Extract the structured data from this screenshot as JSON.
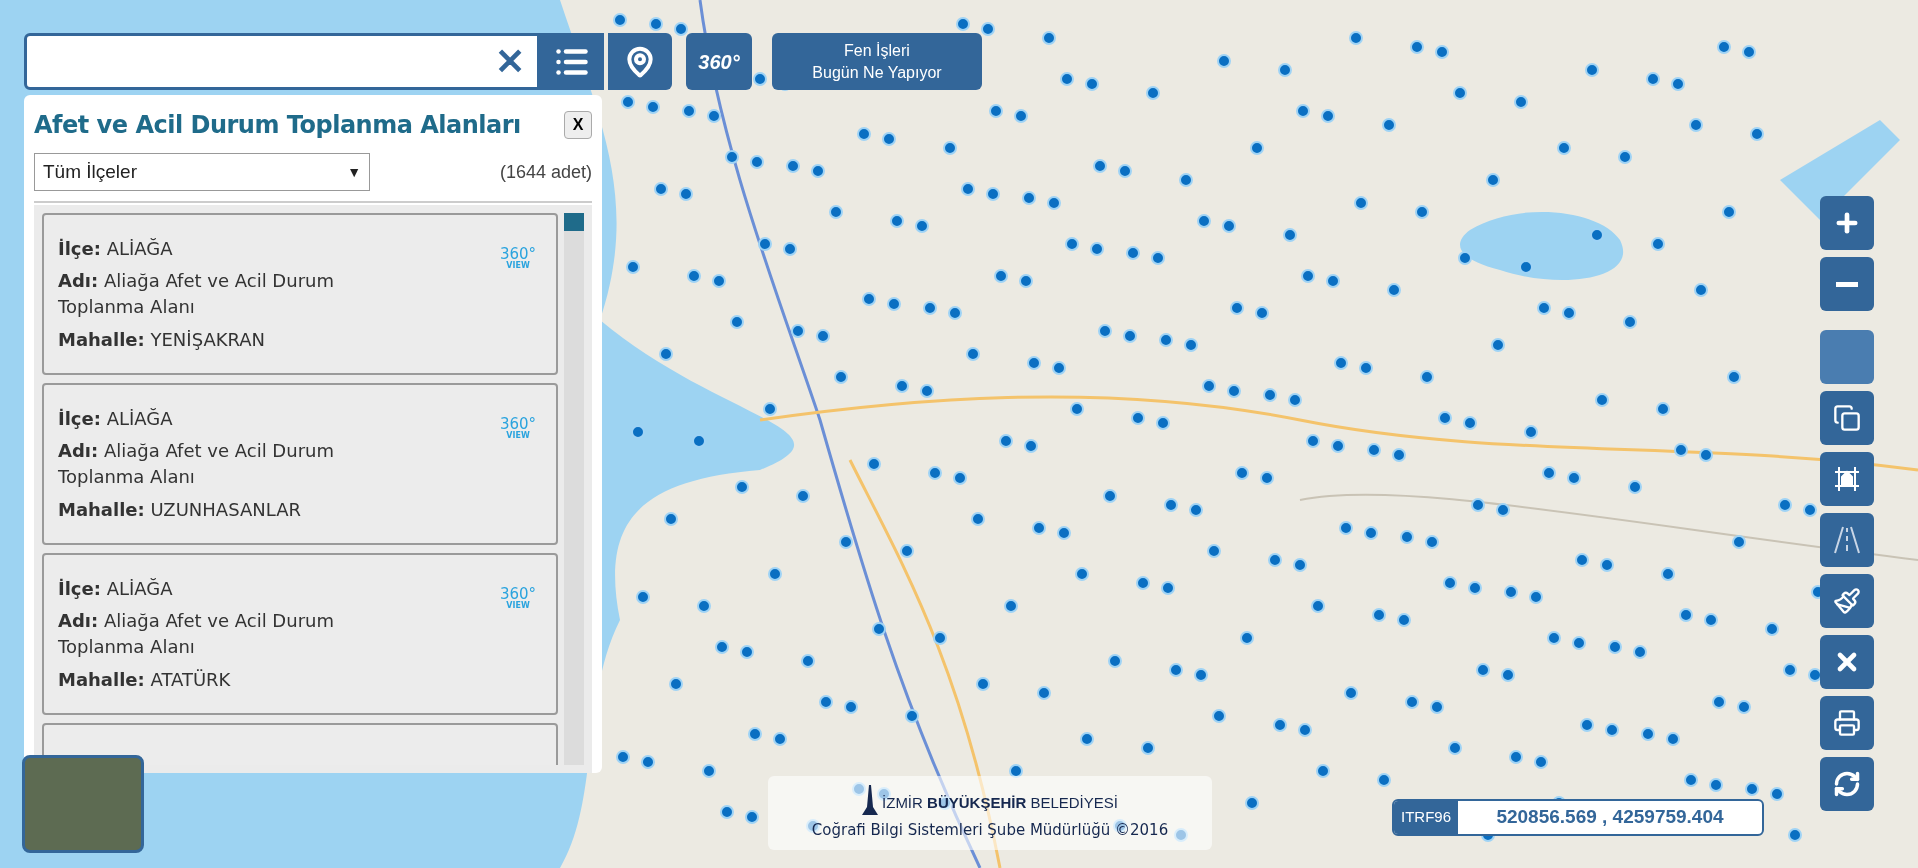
{
  "search": {
    "clear": "✕"
  },
  "toolbar": {
    "view_button": "360°",
    "news_button": [
      "Fen İşleri",
      "Bugün Ne Yapıyor"
    ]
  },
  "panel": {
    "title": "Afet ve Acil Durum Toplanma Alanları",
    "close": "X",
    "district_select": {
      "value": "Tüm İlçeler",
      "arrow": "▼"
    },
    "count": "(1644 adet)",
    "cards": [
      {
        "district_label": "İlçe:",
        "district": "ALİAĞA",
        "name_label": "Adı:",
        "name": "Aliağa Afet ve Acil Durum Toplanma Alanı",
        "neighborhood_label": "Mahalle:",
        "neighborhood": "YENİŞAKRAN",
        "badge": "360°",
        "badge_caption": "VIEW"
      },
      {
        "district_label": "İlçe:",
        "district": "ALİAĞA",
        "name_label": "Adı:",
        "name": "Aliağa Afet ve Acil Durum Toplanma Alanı",
        "neighborhood_label": "Mahalle:",
        "neighborhood": "UZUNHASANLAR",
        "badge": "360°",
        "badge_caption": "VIEW"
      },
      {
        "district_label": "İlçe:",
        "district": "ALİAĞA",
        "name_label": "Adı:",
        "name": "Aliağa Afet ve Acil Durum Toplanma Alanı",
        "neighborhood_label": "Mahalle:",
        "neighborhood": "ATATÜRK",
        "badge": "360°",
        "badge_caption": "VIEW"
      }
    ]
  },
  "map_tools": [
    {
      "kind": "zoom-in",
      "disabled": false
    },
    {
      "kind": "zoom-out",
      "disabled": false
    },
    {
      "kind": "blank",
      "disabled": true
    },
    {
      "kind": "layers",
      "disabled": false
    },
    {
      "kind": "building",
      "disabled": false
    },
    {
      "kind": "road",
      "disabled": false
    },
    {
      "kind": "brush",
      "disabled": false
    },
    {
      "kind": "erase",
      "disabled": false
    },
    {
      "kind": "print",
      "disabled": false
    },
    {
      "kind": "refresh",
      "disabled": false
    }
  ],
  "credits": {
    "logo_text": "İZMİR **BÜYÜKŞEHİR** BELEDİYESİ",
    "department": "Coğrafi Bilgi Sistemleri Şube Müdürlüğü ©2016"
  },
  "coordinates": {
    "system": "ITRF96",
    "value": "520856.569 , 4259759.404"
  }
}
